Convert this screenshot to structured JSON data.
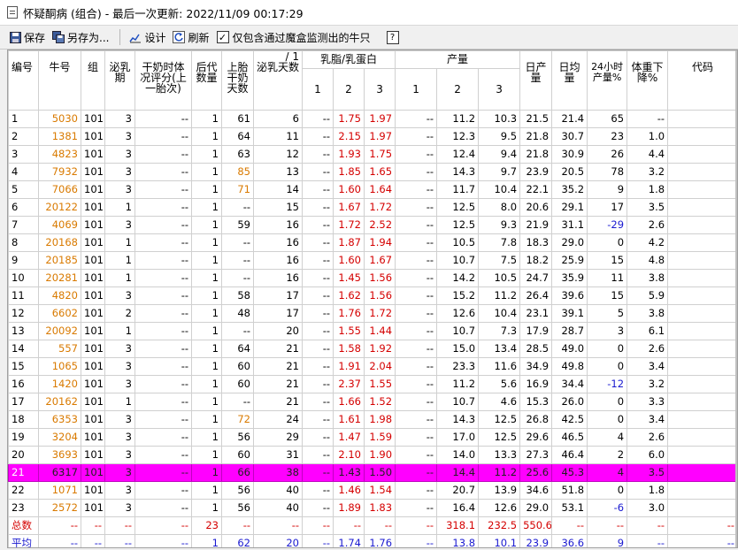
{
  "window": {
    "title": "怀疑酮病 (组合) - 最后一次更新: 2022/11/09 00:17:29",
    "icon": "document-icon"
  },
  "toolbar": {
    "save_label": "保存",
    "save_as_label": "另存为...",
    "design_label": "设计",
    "refresh_label": "刷新",
    "filter_checkbox_label": "仅包含通过魔盒监测出的牛只",
    "filter_checked": true,
    "help_label": "?"
  },
  "headers": {
    "id": "编号",
    "cow": "牛号",
    "group": "组",
    "lactation": "泌乳期",
    "dry_score": "干奶时体况评分(上一胎次)",
    "offspring": "后代数量",
    "dry_days": "上胎干奶天数",
    "dim": "泌乳天数",
    "dim_top": "/ 1",
    "fat_protein": "乳脂/乳蛋白",
    "yield": "产量",
    "sub1": "1",
    "sub2": "2",
    "sub3": "3",
    "daily_yield": "日产量",
    "daily_avg": "日均量",
    "yield24": "24小时产量%",
    "weight_drop": "体重下降%",
    "code": "代码"
  },
  "rows": [
    {
      "id": "1",
      "cow": "5030",
      "group": "101",
      "lact": "3",
      "dry_score": "--",
      "off": "1",
      "dry_days": "61",
      "dim": "6",
      "fp1": "--",
      "fp2": "1.75",
      "fp3": "1.97",
      "y1": "--",
      "y2": "11.2",
      "y3": "10.3",
      "daily": "21.5",
      "avg": "21.4",
      "p24": "65",
      "wd": "--",
      "code": ""
    },
    {
      "id": "2",
      "cow": "1381",
      "group": "101",
      "lact": "3",
      "dry_score": "--",
      "off": "1",
      "dry_days": "64",
      "dim": "11",
      "fp1": "--",
      "fp2": "2.15",
      "fp3": "1.97",
      "y1": "--",
      "y2": "12.3",
      "y3": "9.5",
      "daily": "21.8",
      "avg": "30.7",
      "p24": "23",
      "wd": "1.0",
      "code": ""
    },
    {
      "id": "3",
      "cow": "4823",
      "group": "101",
      "lact": "3",
      "dry_score": "--",
      "off": "1",
      "dry_days": "63",
      "dim": "12",
      "fp1": "--",
      "fp2": "1.93",
      "fp3": "1.75",
      "y1": "--",
      "y2": "12.4",
      "y3": "9.4",
      "daily": "21.8",
      "avg": "30.9",
      "p24": "26",
      "wd": "4.4",
      "code": ""
    },
    {
      "id": "4",
      "cow": "7932",
      "group": "101",
      "lact": "3",
      "dry_score": "--",
      "off": "1",
      "dry_days": "85",
      "dim": "13",
      "fp1": "--",
      "fp2": "1.85",
      "fp3": "1.65",
      "y1": "--",
      "y2": "14.3",
      "y3": "9.7",
      "daily": "23.9",
      "avg": "20.5",
      "p24": "78",
      "wd": "3.2",
      "code": ""
    },
    {
      "id": "5",
      "cow": "7066",
      "group": "101",
      "lact": "3",
      "dry_score": "--",
      "off": "1",
      "dry_days": "71",
      "dim": "14",
      "fp1": "--",
      "fp2": "1.60",
      "fp3": "1.64",
      "y1": "--",
      "y2": "11.7",
      "y3": "10.4",
      "daily": "22.1",
      "avg": "35.2",
      "p24": "9",
      "wd": "1.8",
      "code": ""
    },
    {
      "id": "6",
      "cow": "20122",
      "group": "101",
      "lact": "1",
      "dry_score": "--",
      "off": "1",
      "dry_days": "--",
      "dim": "15",
      "fp1": "--",
      "fp2": "1.67",
      "fp3": "1.72",
      "y1": "--",
      "y2": "12.5",
      "y3": "8.0",
      "daily": "20.6",
      "avg": "29.1",
      "p24": "17",
      "wd": "3.5",
      "code": ""
    },
    {
      "id": "7",
      "cow": "4069",
      "group": "101",
      "lact": "3",
      "dry_score": "--",
      "off": "1",
      "dry_days": "59",
      "dim": "16",
      "fp1": "--",
      "fp2": "1.72",
      "fp3": "2.52",
      "y1": "--",
      "y2": "12.5",
      "y3": "9.3",
      "daily": "21.9",
      "avg": "31.1",
      "p24": "-29",
      "wd": "2.6",
      "code": ""
    },
    {
      "id": "8",
      "cow": "20168",
      "group": "101",
      "lact": "1",
      "dry_score": "--",
      "off": "1",
      "dry_days": "--",
      "dim": "16",
      "fp1": "--",
      "fp2": "1.87",
      "fp3": "1.94",
      "y1": "--",
      "y2": "10.5",
      "y3": "7.8",
      "daily": "18.3",
      "avg": "29.0",
      "p24": "0",
      "wd": "4.2",
      "code": ""
    },
    {
      "id": "9",
      "cow": "20185",
      "group": "101",
      "lact": "1",
      "dry_score": "--",
      "off": "1",
      "dry_days": "--",
      "dim": "16",
      "fp1": "--",
      "fp2": "1.60",
      "fp3": "1.67",
      "y1": "--",
      "y2": "10.7",
      "y3": "7.5",
      "daily": "18.2",
      "avg": "25.9",
      "p24": "15",
      "wd": "4.8",
      "code": ""
    },
    {
      "id": "10",
      "cow": "20281",
      "group": "101",
      "lact": "1",
      "dry_score": "--",
      "off": "1",
      "dry_days": "--",
      "dim": "16",
      "fp1": "--",
      "fp2": "1.45",
      "fp3": "1.56",
      "y1": "--",
      "y2": "14.2",
      "y3": "10.5",
      "daily": "24.7",
      "avg": "35.9",
      "p24": "11",
      "wd": "3.8",
      "code": ""
    },
    {
      "id": "11",
      "cow": "4820",
      "group": "101",
      "lact": "3",
      "dry_score": "--",
      "off": "1",
      "dry_days": "58",
      "dim": "17",
      "fp1": "--",
      "fp2": "1.62",
      "fp3": "1.56",
      "y1": "--",
      "y2": "15.2",
      "y3": "11.2",
      "daily": "26.4",
      "avg": "39.6",
      "p24": "15",
      "wd": "5.9",
      "code": ""
    },
    {
      "id": "12",
      "cow": "6602",
      "group": "101",
      "lact": "2",
      "dry_score": "--",
      "off": "1",
      "dry_days": "48",
      "dim": "17",
      "fp1": "--",
      "fp2": "1.76",
      "fp3": "1.72",
      "y1": "--",
      "y2": "12.6",
      "y3": "10.4",
      "daily": "23.1",
      "avg": "39.1",
      "p24": "5",
      "wd": "3.8",
      "code": ""
    },
    {
      "id": "13",
      "cow": "20092",
      "group": "101",
      "lact": "1",
      "dry_score": "--",
      "off": "1",
      "dry_days": "--",
      "dim": "20",
      "fp1": "--",
      "fp2": "1.55",
      "fp3": "1.44",
      "y1": "--",
      "y2": "10.7",
      "y3": "7.3",
      "daily": "17.9",
      "avg": "28.7",
      "p24": "3",
      "wd": "6.1",
      "code": ""
    },
    {
      "id": "14",
      "cow": "557",
      "group": "101",
      "lact": "3",
      "dry_score": "--",
      "off": "1",
      "dry_days": "64",
      "dim": "21",
      "fp1": "--",
      "fp2": "1.58",
      "fp3": "1.92",
      "y1": "--",
      "y2": "15.0",
      "y3": "13.4",
      "daily": "28.5",
      "avg": "49.0",
      "p24": "0",
      "wd": "2.6",
      "code": ""
    },
    {
      "id": "15",
      "cow": "1065",
      "group": "101",
      "lact": "3",
      "dry_score": "--",
      "off": "1",
      "dry_days": "60",
      "dim": "21",
      "fp1": "--",
      "fp2": "1.91",
      "fp3": "2.04",
      "y1": "--",
      "y2": "23.3",
      "y3": "11.6",
      "daily": "34.9",
      "avg": "49.8",
      "p24": "0",
      "wd": "3.4",
      "code": ""
    },
    {
      "id": "16",
      "cow": "1420",
      "group": "101",
      "lact": "3",
      "dry_score": "--",
      "off": "1",
      "dry_days": "60",
      "dim": "21",
      "fp1": "--",
      "fp2": "2.37",
      "fp3": "1.55",
      "y1": "--",
      "y2": "11.2",
      "y3": "5.6",
      "daily": "16.9",
      "avg": "34.4",
      "p24": "-12",
      "wd": "3.2",
      "code": ""
    },
    {
      "id": "17",
      "cow": "20162",
      "group": "101",
      "lact": "1",
      "dry_score": "--",
      "off": "1",
      "dry_days": "--",
      "dim": "21",
      "fp1": "--",
      "fp2": "1.66",
      "fp3": "1.52",
      "y1": "--",
      "y2": "10.7",
      "y3": "4.6",
      "daily": "15.3",
      "avg": "26.0",
      "p24": "0",
      "wd": "3.3",
      "code": ""
    },
    {
      "id": "18",
      "cow": "6353",
      "group": "101",
      "lact": "3",
      "dry_score": "--",
      "off": "1",
      "dry_days": "72",
      "dim": "24",
      "fp1": "--",
      "fp2": "1.61",
      "fp3": "1.98",
      "y1": "--",
      "y2": "14.3",
      "y3": "12.5",
      "daily": "26.8",
      "avg": "42.5",
      "p24": "0",
      "wd": "3.4",
      "code": ""
    },
    {
      "id": "19",
      "cow": "3204",
      "group": "101",
      "lact": "3",
      "dry_score": "--",
      "off": "1",
      "dry_days": "56",
      "dim": "29",
      "fp1": "--",
      "fp2": "1.47",
      "fp3": "1.59",
      "y1": "--",
      "y2": "17.0",
      "y3": "12.5",
      "daily": "29.6",
      "avg": "46.5",
      "p24": "4",
      "wd": "2.6",
      "code": ""
    },
    {
      "id": "20",
      "cow": "3693",
      "group": "101",
      "lact": "3",
      "dry_score": "--",
      "off": "1",
      "dry_days": "60",
      "dim": "31",
      "fp1": "--",
      "fp2": "2.10",
      "fp3": "1.90",
      "y1": "--",
      "y2": "14.0",
      "y3": "13.3",
      "daily": "27.3",
      "avg": "46.4",
      "p24": "2",
      "wd": "6.0",
      "code": ""
    },
    {
      "id": "21",
      "cow": "6317",
      "group": "101",
      "lact": "3",
      "dry_score": "--",
      "off": "1",
      "dry_days": "66",
      "dim": "38",
      "fp1": "--",
      "fp2": "1.43",
      "fp3": "1.50",
      "y1": "--",
      "y2": "14.4",
      "y3": "11.2",
      "daily": "25.6",
      "avg": "45.3",
      "p24": "4",
      "wd": "3.5",
      "code": "",
      "highlight": true
    },
    {
      "id": "22",
      "cow": "1071",
      "group": "101",
      "lact": "3",
      "dry_score": "--",
      "off": "1",
      "dry_days": "56",
      "dim": "40",
      "fp1": "--",
      "fp2": "1.46",
      "fp3": "1.54",
      "y1": "--",
      "y2": "20.7",
      "y3": "13.9",
      "daily": "34.6",
      "avg": "51.8",
      "p24": "0",
      "wd": "1.8",
      "code": ""
    },
    {
      "id": "23",
      "cow": "2572",
      "group": "101",
      "lact": "3",
      "dry_score": "--",
      "off": "1",
      "dry_days": "56",
      "dim": "40",
      "fp1": "--",
      "fp2": "1.89",
      "fp3": "1.83",
      "y1": "--",
      "y2": "16.4",
      "y3": "12.6",
      "daily": "29.0",
      "avg": "53.1",
      "p24": "-6",
      "wd": "3.0",
      "code": ""
    }
  ],
  "total_row": {
    "id": "总数",
    "cow": "--",
    "group": "--",
    "lact": "--",
    "dry_score": "--",
    "off": "23",
    "dry_days": "--",
    "dim": "--",
    "fp1": "--",
    "fp2": "--",
    "fp3": "--",
    "y1": "--",
    "y2": "318.1",
    "y3": "232.5",
    "daily": "550.6",
    "avg": "--",
    "p24": "--",
    "wd": "--",
    "code": "--"
  },
  "avg_row": {
    "id": "平均",
    "cow": "--",
    "group": "--",
    "lact": "--",
    "dry_score": "--",
    "off": "1",
    "dry_days": "62",
    "dim": "20",
    "fp1": "--",
    "fp2": "1.74",
    "fp3": "1.76",
    "y1": "--",
    "y2": "13.8",
    "y3": "10.1",
    "daily": "23.9",
    "avg": "36.6",
    "p24": "9",
    "wd": "--",
    "code": "--"
  },
  "colors": {
    "highlight_row": "#ff00ff",
    "cow_id_orange": "#d97a00",
    "fat_protein_red": "#d40000",
    "negative_blue": "#1a1ad0",
    "total_red": "#d40000",
    "average_blue": "#1a1ad0"
  }
}
